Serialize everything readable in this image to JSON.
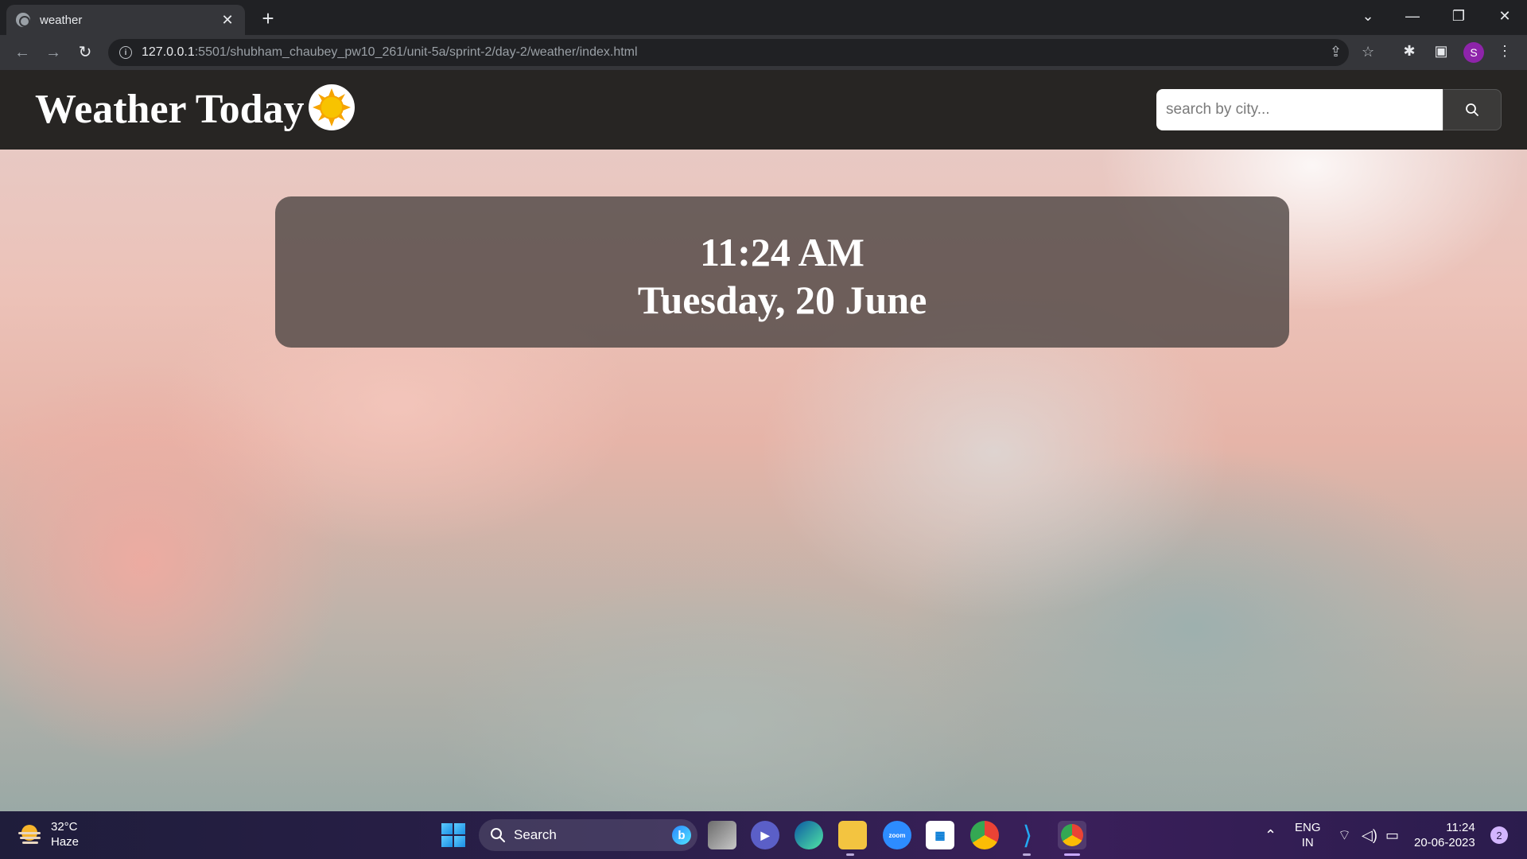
{
  "browser": {
    "tab_title": "weather",
    "url_host": "127.0.0.1",
    "url_path": ":5501/shubham_chaubey_pw10_261/unit-5a/sprint-2/day-2/weather/index.html",
    "profile_initial": "S"
  },
  "page": {
    "title": "Weather Today",
    "search_placeholder": "search by city...",
    "time": "11:24 AM",
    "date": "Tuesday, 20 June"
  },
  "taskbar": {
    "weather_temp": "32°C",
    "weather_desc": "Haze",
    "search_label": "Search",
    "lang_line1": "ENG",
    "lang_line2": "IN",
    "clock_time": "11:24",
    "clock_date": "20-06-2023",
    "notification_count": "2",
    "zoom_label": "zoom"
  },
  "colors": {
    "header_bg": "#272523",
    "card_bg": "#504846",
    "taskbar_accent": "#3a1f5a"
  }
}
